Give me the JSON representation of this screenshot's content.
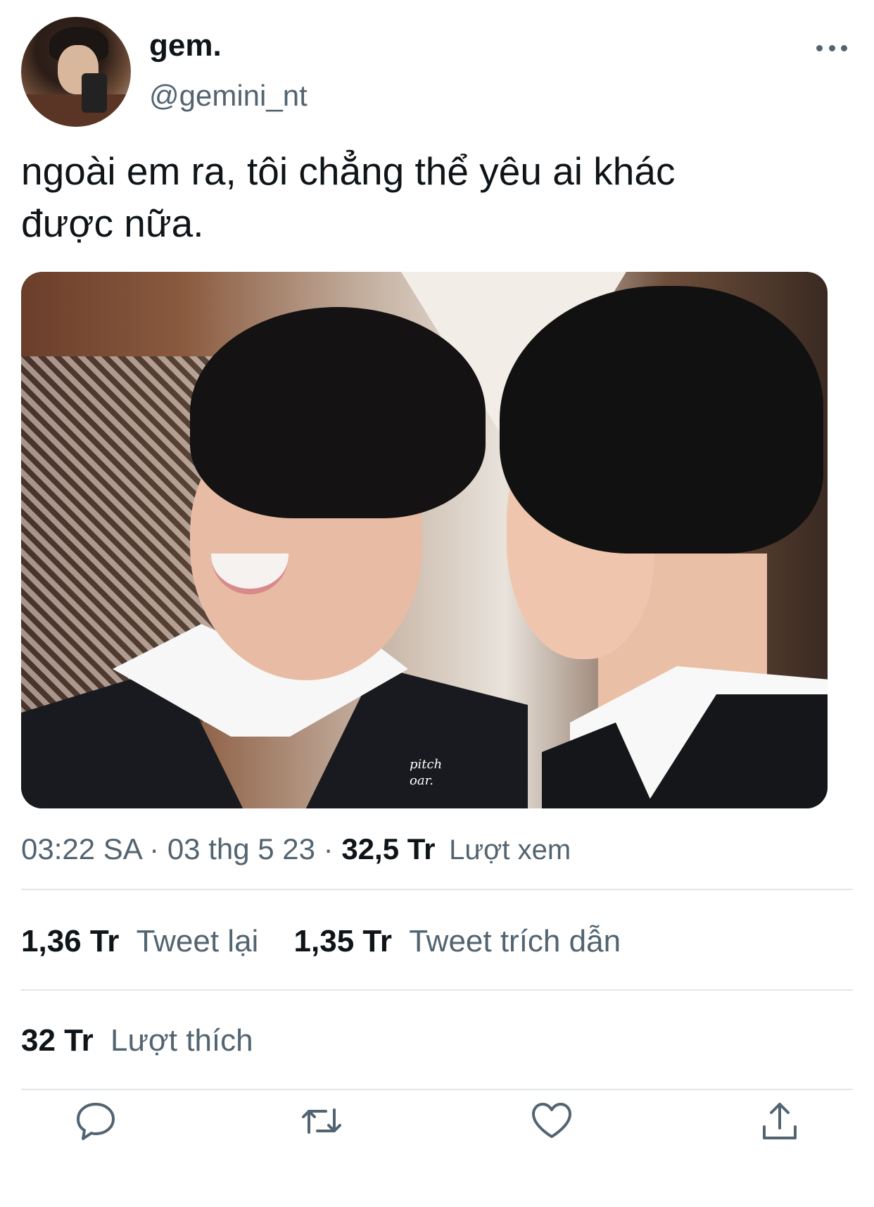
{
  "user": {
    "display_name": "gem.",
    "handle": "@gemini_nt"
  },
  "more_icon": "more-horizontal-icon",
  "tweet": {
    "text_line1": "ngoài em ra, tôi chẳng thể yêu ai khác",
    "text_line2": "được nữa.",
    "media_watermark": "pitch\noar."
  },
  "meta": {
    "time": "03:22 SA",
    "date": "03 thg 5 23",
    "views_count": "32,5 Tr",
    "views_label": "Lượt xem"
  },
  "stats": {
    "retweets_count": "1,36 Tr",
    "retweets_label": "Tweet lại",
    "quotes_count": "1,35 Tr",
    "quotes_label": "Tweet trích dẫn",
    "likes_count": "32 Tr",
    "likes_label": "Lượt thích"
  },
  "actions": [
    {
      "name": "reply",
      "icon": "reply-icon"
    },
    {
      "name": "retweet",
      "icon": "retweet-icon"
    },
    {
      "name": "like",
      "icon": "heart-icon"
    },
    {
      "name": "share",
      "icon": "share-icon"
    }
  ],
  "colors": {
    "text_primary": "#0f1419",
    "text_secondary": "#536471",
    "divider": "#e3e6e8",
    "icon": "#536471"
  }
}
